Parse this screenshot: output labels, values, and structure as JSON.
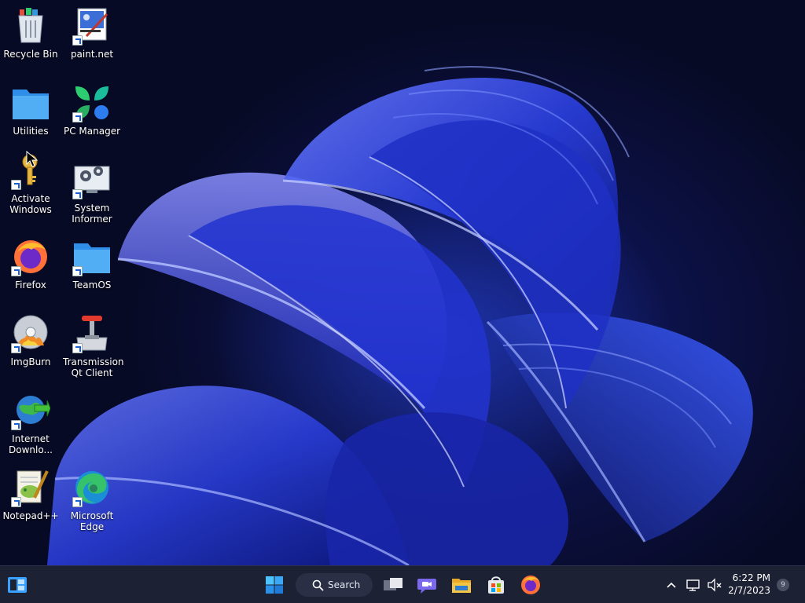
{
  "desktop": {
    "icons": [
      {
        "label": "Recycle Bin",
        "icon": "recycle-bin-icon"
      },
      {
        "label": "paint.net",
        "icon": "paintnet-icon"
      },
      {
        "label": "Utilities",
        "icon": "folder-icon"
      },
      {
        "label": "PC Manager",
        "icon": "pc-manager-icon"
      },
      {
        "label": "Activate Windows",
        "icon": "key-icon"
      },
      {
        "label": "System Informer",
        "icon": "system-informer-icon"
      },
      {
        "label": "Firefox",
        "icon": "firefox-icon"
      },
      {
        "label": "TeamOS",
        "icon": "folder-icon"
      },
      {
        "label": "ImgBurn",
        "icon": "imgburn-icon"
      },
      {
        "label": "Transmission Qt Client",
        "icon": "transmission-icon"
      },
      {
        "label": "Internet Downlo...",
        "icon": "internet-download-manager-icon"
      },
      {
        "label": "Notepad++",
        "icon": "notepad-plus-plus-icon"
      },
      {
        "label": "Microsoft Edge",
        "icon": "edge-icon"
      }
    ]
  },
  "taskbar": {
    "search_label": "Search",
    "pinned": [
      {
        "name": "start",
        "icon": "windows-start-icon"
      },
      {
        "name": "task-view",
        "icon": "task-view-icon"
      },
      {
        "name": "teams-chat",
        "icon": "teams-chat-icon"
      },
      {
        "name": "file-explorer",
        "icon": "file-explorer-icon"
      },
      {
        "name": "microsoft-store",
        "icon": "microsoft-store-icon"
      },
      {
        "name": "firefox",
        "icon": "firefox-icon"
      }
    ],
    "clock_time": "6:22 PM",
    "clock_date": "2/7/2023",
    "notification_count": "9"
  },
  "colors": {
    "taskbar_bg": "#1d2134",
    "wallpaper_accent": "#2f55ff",
    "windows_blue": "#0078d4"
  }
}
